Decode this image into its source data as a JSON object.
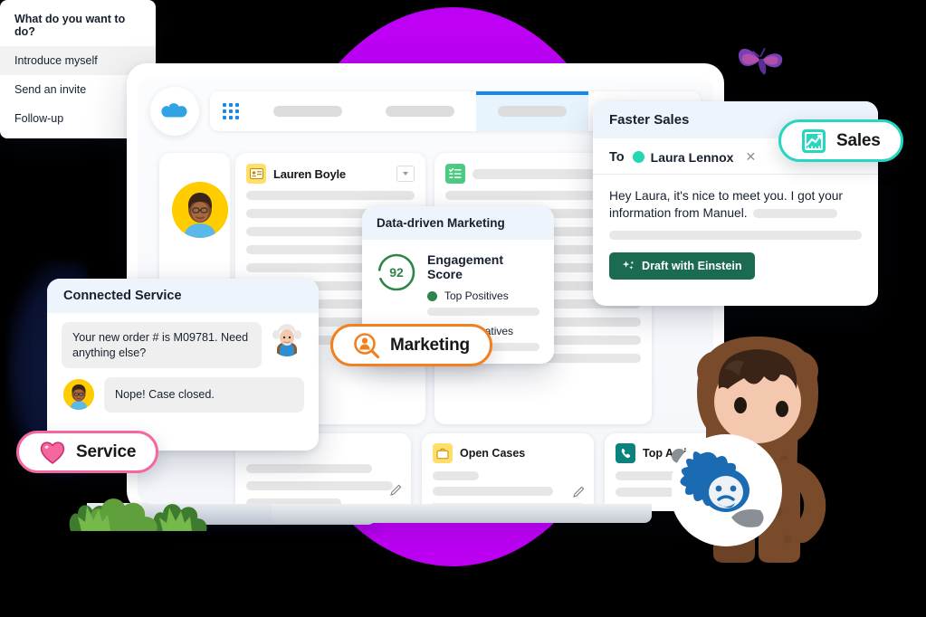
{
  "background": {
    "circle_color": "#BE00F5",
    "butterfly": "butterfly-icon"
  },
  "browser": {
    "logo": "salesforce-cloud-logo",
    "app_launcher": "app-launcher-icon",
    "tabs": [
      {
        "name": "tab-1",
        "label": "",
        "active": false
      },
      {
        "name": "tab-2",
        "label": "",
        "active": false
      },
      {
        "name": "tab-3",
        "label": "",
        "active": true
      },
      {
        "name": "tab-4",
        "label": "",
        "active": false
      }
    ],
    "active_tab_color": "#1589EE"
  },
  "record": {
    "icon": "contact-card-icon",
    "name": "Lauren Boyle",
    "avatar": "user-avatar-lauren-boyle",
    "dropdown": "chevron-down-icon"
  },
  "right_panel": {
    "icon": "task-list-icon"
  },
  "bottom_cards": [
    {
      "name": "open-cases",
      "icon": "briefcase-icon",
      "title": "Open Cases",
      "icon_color": "#FFDE6A"
    },
    {
      "name": "top-activities",
      "icon": "phone-icon",
      "title": "Top Activities",
      "icon_color": "#0B827C"
    }
  ],
  "sales_panel": {
    "title": "Faster Sales",
    "to_label": "To",
    "recipient": "Laura Lennox",
    "recipient_dot_color": "#24D6B4",
    "remove_icon": "close-icon",
    "message": "Hey Laura, it's nice to meet you. I got your information from Manuel.",
    "button_label": "Draft with Einstein",
    "button_icon": "sparkle-icon",
    "button_color": "#1A6B52"
  },
  "menu": {
    "title": "What do you want to do?",
    "items": [
      "Introduce myself",
      "Send an invite",
      "Follow-up"
    ],
    "highlighted": "Introduce myself"
  },
  "marketing_panel": {
    "title": "Data-driven Marketing",
    "score": "92",
    "score_label": "Engagement Score",
    "legend": [
      {
        "label": "Top Positives",
        "color": "#2E844A"
      },
      {
        "label": "Top Negatives",
        "color": "#2E844A"
      }
    ]
  },
  "service_panel": {
    "title": "Connected Service",
    "messages": [
      {
        "from": "agent",
        "avatar": "einstein-avatar",
        "text": "Your new order # is M09781. Need anything else?"
      },
      {
        "from": "customer",
        "avatar": "user-avatar-customer",
        "text": "Nope! Case closed."
      }
    ]
  },
  "pills": [
    {
      "name": "sales",
      "label": "Sales",
      "icon": "chart-trend-icon",
      "border_color": "#26D6C0"
    },
    {
      "name": "marketing",
      "label": "Marketing",
      "icon": "audience-search-icon",
      "border_color": "#F08020"
    },
    {
      "name": "service",
      "label": "Service",
      "icon": "heart-icon",
      "border_color": "#F7679F"
    }
  ],
  "mascot": {
    "name": "astro-mascot",
    "sign_icon": "einstein-face-icon"
  }
}
